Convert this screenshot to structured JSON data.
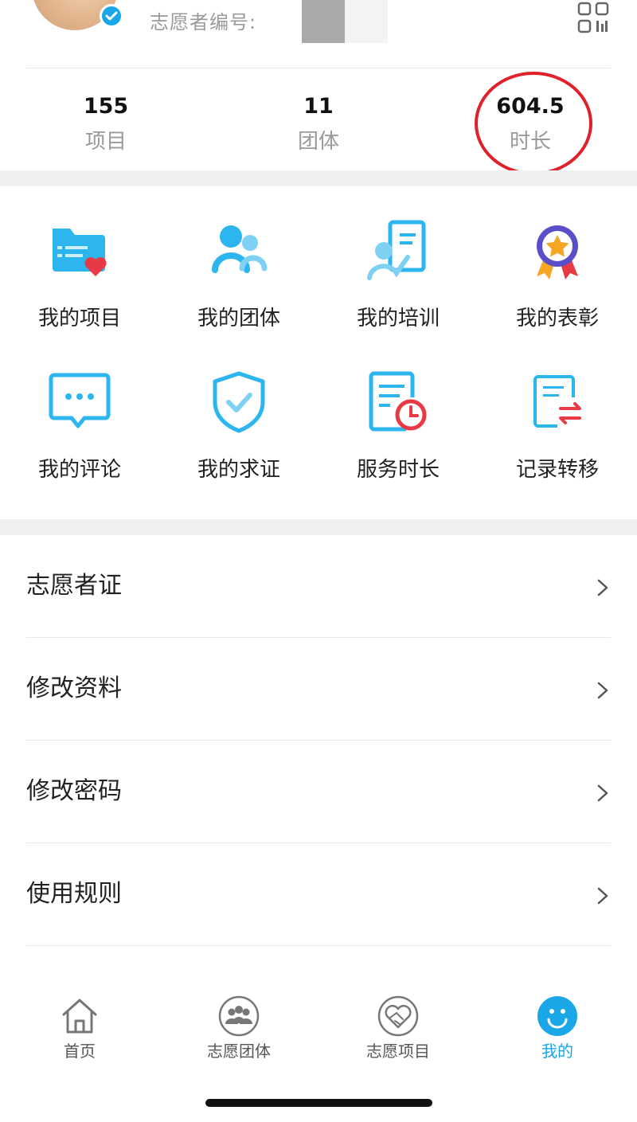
{
  "profile": {
    "volunteer_id_label": "志愿者编号:",
    "verified_icon": "verified-check-icon",
    "qr_icon": "qr-code-icon"
  },
  "stats": [
    {
      "value": "155",
      "label": "项目"
    },
    {
      "value": "11",
      "label": "团体"
    },
    {
      "value": "604.5",
      "label": "时长"
    }
  ],
  "grid": [
    {
      "label": "我的项目",
      "icon": "folder-heart-icon"
    },
    {
      "label": "我的团体",
      "icon": "group-icon"
    },
    {
      "label": "我的培训",
      "icon": "training-icon"
    },
    {
      "label": "我的表彰",
      "icon": "medal-icon"
    },
    {
      "label": "我的评论",
      "icon": "comment-icon"
    },
    {
      "label": "我的求证",
      "icon": "shield-check-icon"
    },
    {
      "label": "服务时长",
      "icon": "document-clock-icon"
    },
    {
      "label": "记录转移",
      "icon": "document-transfer-icon"
    }
  ],
  "menu": [
    {
      "label": "志愿者证"
    },
    {
      "label": "修改资料"
    },
    {
      "label": "修改密码"
    },
    {
      "label": "使用规则"
    }
  ],
  "tabs": [
    {
      "label": "首页",
      "icon": "home-icon"
    },
    {
      "label": "志愿团体",
      "icon": "team-icon"
    },
    {
      "label": "志愿项目",
      "icon": "heart-handshake-icon"
    },
    {
      "label": "我的",
      "icon": "smile-icon",
      "active": true
    }
  ],
  "colors": {
    "accent": "#1aa7e8",
    "icon_blue": "#2cb5ee",
    "highlight_red": "#e0212a",
    "heart_red": "#e83a45"
  }
}
